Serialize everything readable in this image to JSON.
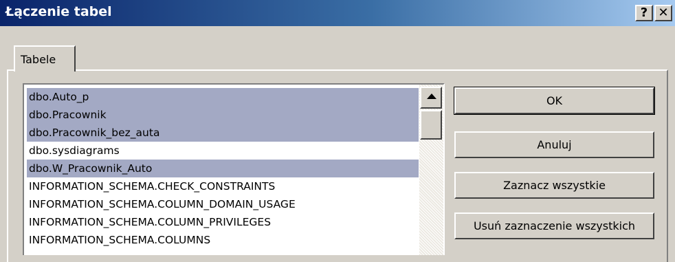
{
  "window": {
    "title": "Łączenie tabel",
    "help_label": "?",
    "close_label": "✕"
  },
  "tabs": [
    {
      "label": "Tabele",
      "active": true
    }
  ],
  "list": {
    "items": [
      {
        "label": "dbo.Auto_p",
        "selected": true
      },
      {
        "label": "dbo.Pracownik",
        "selected": true
      },
      {
        "label": "dbo.Pracownik_bez_auta",
        "selected": true
      },
      {
        "label": "dbo.sysdiagrams",
        "selected": false
      },
      {
        "label": "dbo.W_Pracownik_Auto",
        "selected": true
      },
      {
        "label": "INFORMATION_SCHEMA.CHECK_CONSTRAINTS",
        "selected": false
      },
      {
        "label": "INFORMATION_SCHEMA.COLUMN_DOMAIN_USAGE",
        "selected": false
      },
      {
        "label": "INFORMATION_SCHEMA.COLUMN_PRIVILEGES",
        "selected": false
      },
      {
        "label": "INFORMATION_SCHEMA.COLUMNS",
        "selected": false
      }
    ]
  },
  "buttons": {
    "ok": "OK",
    "cancel": "Anuluj",
    "select_all": "Zaznacz wszystkie",
    "deselect_all": "Usuń zaznaczenie wszystkich"
  },
  "colors": {
    "selection": "#a3a9c4",
    "title_start": "#0a246a",
    "title_end": "#a6caf0"
  },
  "icons": [
    "help-icon",
    "close-icon",
    "scroll-up-arrow-icon"
  ]
}
